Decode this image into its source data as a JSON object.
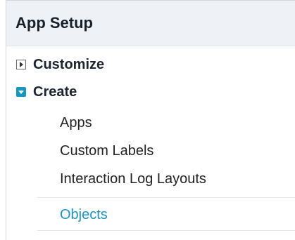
{
  "setup": {
    "title": "App Setup",
    "tree": {
      "customize": {
        "label": "Customize",
        "expanded": false
      },
      "create": {
        "label": "Create",
        "expanded": true,
        "children": [
          {
            "label": "Apps"
          },
          {
            "label": "Custom Labels"
          },
          {
            "label": "Interaction Log Layouts"
          },
          {
            "label": "Objects",
            "selected": true
          }
        ]
      }
    }
  },
  "colors": {
    "header_bg": "#eef1f5",
    "accent": "#1798c1",
    "selected_text": "#1a93c7"
  },
  "icons": {
    "collapsed": "triangle-right-icon",
    "expanded": "triangle-down-icon"
  }
}
